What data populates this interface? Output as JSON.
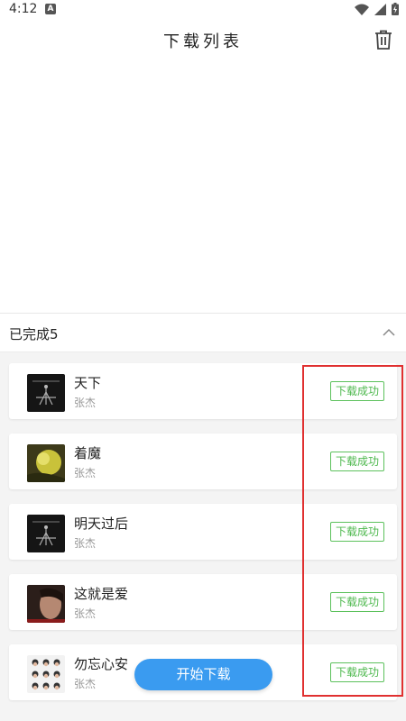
{
  "status_bar": {
    "time": "4:12",
    "notification_icon": "A"
  },
  "header": {
    "title": "下载列表",
    "trash_icon": "trash-icon"
  },
  "section": {
    "title": "已完成5",
    "collapse_icon": "chevron-up-icon"
  },
  "songs": [
    {
      "title": "天下",
      "artist": "张杰",
      "status": "下载成功"
    },
    {
      "title": "着魔",
      "artist": "张杰",
      "status": "下载成功"
    },
    {
      "title": "明天过后",
      "artist": "张杰",
      "status": "下载成功"
    },
    {
      "title": "这就是爱",
      "artist": "张杰",
      "status": "下载成功"
    },
    {
      "title": "勿忘心安",
      "artist": "张杰",
      "status": "下载成功"
    }
  ],
  "start_button": {
    "label": "开始下载"
  },
  "colors": {
    "accent": "#3a9bf0",
    "success": "#4db84d",
    "highlight": "#e03030"
  }
}
